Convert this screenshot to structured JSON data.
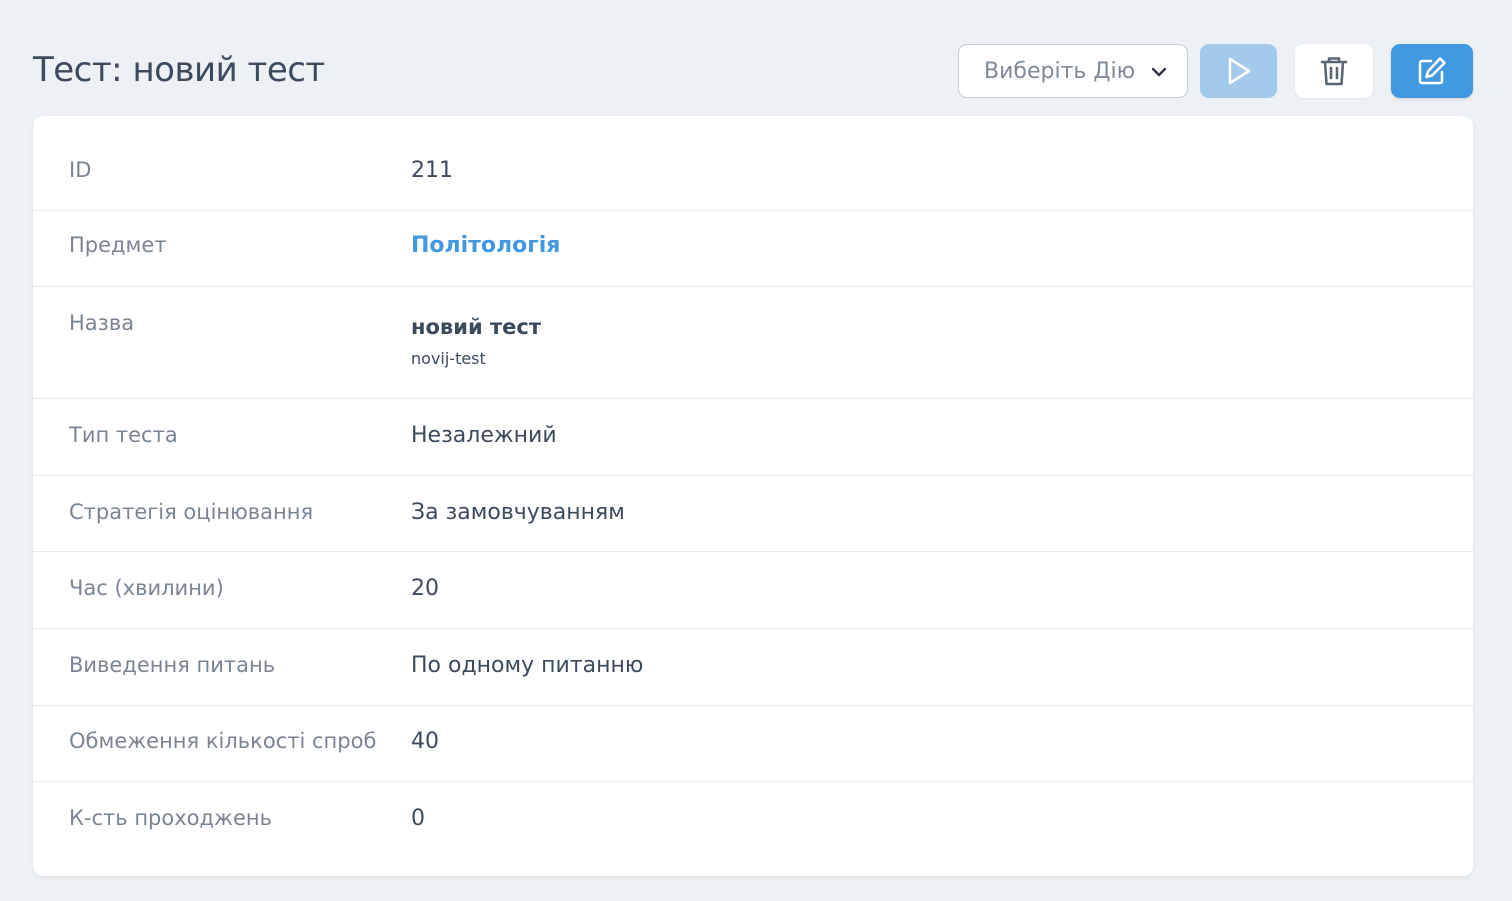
{
  "page": {
    "title": "Тест: новий тест"
  },
  "toolbar": {
    "action_select": "Виберіть Дію",
    "run_icon": "play-icon",
    "delete_icon": "trash-icon",
    "edit_icon": "edit-icon"
  },
  "colors": {
    "background": "#edf0f4",
    "primary": "#4299e1",
    "primary_disabled": "#a3c9ec",
    "text": "#3c4a5e",
    "muted": "#7a8594"
  },
  "details": [
    {
      "label": "ID",
      "value": "211"
    },
    {
      "label": "Предмет",
      "value": "Політологія"
    },
    {
      "label": "Назва",
      "value": "новий тест",
      "sub": "novij-test"
    },
    {
      "label": "Тип теста",
      "value": "Незалежний"
    },
    {
      "label": "Стратегія оцінювання",
      "value": "За замовчуванням"
    },
    {
      "label": "Час (хвилини)",
      "value": "20"
    },
    {
      "label": "Виведення питань",
      "value": "По одному питанню"
    },
    {
      "label": "Обмеження кількості спроб",
      "value": "40"
    },
    {
      "label": "К-сть проходжень",
      "value": "0"
    }
  ]
}
